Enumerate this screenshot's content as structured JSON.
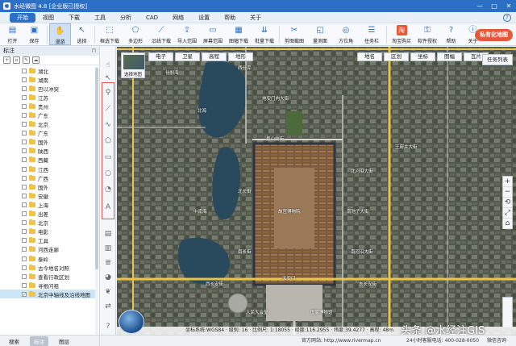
{
  "window": {
    "title": "水经微图 4.8 [企业版已授权]",
    "controls": [
      "—",
      "□",
      "✕"
    ]
  },
  "menu": {
    "items": [
      "开始",
      "视图",
      "下载",
      "工具",
      "分析",
      "CAD",
      "网络",
      "设置",
      "帮助",
      "关于"
    ],
    "active_index": 0
  },
  "toolbar": {
    "tools": [
      {
        "label": "打开",
        "icon": "folder-icon",
        "glyph": "▤"
      },
      {
        "label": "保存",
        "icon": "save-icon",
        "glyph": "▣"
      },
      {
        "label": "漫游",
        "icon": "hand-icon",
        "glyph": "✋",
        "active": true
      },
      {
        "label": "选择",
        "icon": "cursor-icon",
        "glyph": "↖"
      },
      {
        "label": "框选下载",
        "icon": "rect-download-icon",
        "glyph": "⬚"
      },
      {
        "label": "多边形",
        "icon": "polygon-icon",
        "glyph": "⬠"
      },
      {
        "label": "沿线下载",
        "icon": "line-download-icon",
        "glyph": "⟋"
      },
      {
        "label": "导入范围",
        "icon": "import-range-icon",
        "glyph": "⇪"
      },
      {
        "label": "屏幕范围",
        "icon": "screen-range-icon",
        "glyph": "▭"
      },
      {
        "label": "图幅下载",
        "icon": "sheet-download-icon",
        "glyph": "▦"
      },
      {
        "label": "批量下载",
        "icon": "batch-download-icon",
        "glyph": "⇊"
      },
      {
        "label": "剪图截图",
        "icon": "clip-icon",
        "glyph": "✂"
      },
      {
        "label": "量测面",
        "icon": "measure-area-icon",
        "glyph": "◱"
      },
      {
        "label": "方位角",
        "icon": "compass-icon",
        "glyph": "◎"
      },
      {
        "label": "任务栏",
        "icon": "tasklist-icon",
        "glyph": "☰"
      },
      {
        "label": "淘宝购买",
        "icon": "taobao-icon",
        "glyph": "淘"
      },
      {
        "label": "软件授权",
        "icon": "license-icon",
        "glyph": "⚿"
      },
      {
        "label": "帮助",
        "icon": "help-icon",
        "glyph": "?"
      },
      {
        "label": "关于",
        "icon": "about-icon",
        "glyph": "ⓘ"
      }
    ],
    "promo_label": "私有化地图"
  },
  "left_panel": {
    "title": "标注",
    "items": [
      {
        "label": "湖北",
        "checked": false
      },
      {
        "label": "湖南",
        "checked": false
      },
      {
        "label": "巴以冲突",
        "checked": false
      },
      {
        "label": "江苏",
        "checked": false
      },
      {
        "label": "贵州",
        "checked": false
      },
      {
        "label": "广东",
        "checked": false
      },
      {
        "label": "北京",
        "checked": false
      },
      {
        "label": "广东",
        "checked": false
      },
      {
        "label": "国外",
        "checked": false
      },
      {
        "label": "陕西",
        "checked": false
      },
      {
        "label": "西藏",
        "checked": false
      },
      {
        "label": "江西",
        "checked": false
      },
      {
        "label": "广西",
        "checked": false
      },
      {
        "label": "国外",
        "checked": false
      },
      {
        "label": "安徽",
        "checked": false
      },
      {
        "label": "上海",
        "checked": false
      },
      {
        "label": "出差",
        "checked": false
      },
      {
        "label": "北京",
        "checked": false
      },
      {
        "label": "电影",
        "checked": false
      },
      {
        "label": "工具",
        "checked": false
      },
      {
        "label": "河西走廊",
        "checked": false
      },
      {
        "label": "泰岭",
        "checked": false
      },
      {
        "label": "古今地名对照",
        "checked": false
      },
      {
        "label": "查看行政区划",
        "checked": false
      },
      {
        "label": "寻根问祖",
        "checked": false
      },
      {
        "label": "北京中轴线及沿线地图",
        "checked": true,
        "selected": true
      }
    ],
    "tabs": [
      "搜索",
      "标注",
      "图层"
    ],
    "active_tab": 1
  },
  "map": {
    "layer_thumb_label": "选择地图",
    "top_buttons_left": [
      "电子",
      "卫星",
      "高程",
      "地形"
    ],
    "top_buttons_right": [
      "地名",
      "区划",
      "坐标",
      "图幅",
      "瓦片"
    ],
    "task_button": "任务列表",
    "zoom_controls": [
      "+",
      "−",
      "⟲",
      "⤢",
      "⌂"
    ],
    "labels": [
      "西什库",
      "什刹海",
      "地安门内大街",
      "景山前街",
      "故宫博物院",
      "北长街",
      "南长街",
      "南池子大街",
      "西长安街",
      "东长安街",
      "中南海",
      "北海",
      "天安门",
      "人民大会堂",
      "国家博物馆",
      "南河沿大街",
      "北河沿大街",
      "王府井大街"
    ],
    "status_text": "坐标系统:WGS84 · 级别: 16 · 比例尺: 1:18055 · 经度:116.2955 · 纬度:39.4277  ·  高程: 48m",
    "watermark": "头条 @水经注GIS"
  },
  "statusbar": {
    "website": "官方网站: http://www.rivermap.cn",
    "hotline": "24小时客服电话: 400-028-0050",
    "wechat": "微信咨询"
  },
  "colors": {
    "accent": "#2b6fc6",
    "promo": "#e8573a",
    "road": "#e8c44a",
    "water": "#294a5c"
  }
}
